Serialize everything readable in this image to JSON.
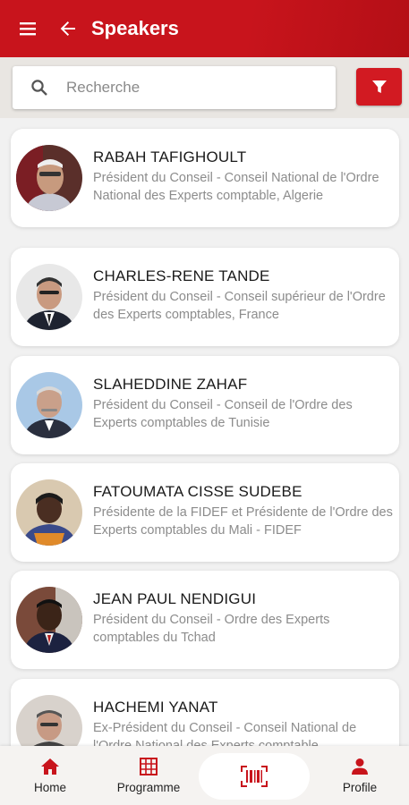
{
  "header": {
    "title": "Speakers",
    "menu_icon": "hamburger-menu-icon",
    "back_icon": "arrow-left-icon",
    "bg_color": "#c8141c"
  },
  "search": {
    "placeholder": "Recherche",
    "value": "",
    "filter_icon": "filter-funnel-icon",
    "filter_color": "#d21a22"
  },
  "speakers": [
    {
      "name": "RABAH TAFIGHOULT",
      "role": "Président du Conseil - Conseil National de l'Ordre National des Experts comptable, Algerie"
    },
    {
      "name": "CHARLES-RENE TANDE",
      "role": "Président du Conseil - Conseil supérieur de l'Ordre des Experts comptables, France"
    },
    {
      "name": "SLAHEDDINE ZAHAF",
      "role": "Président du Conseil - Conseil de l'Ordre des Experts comptables  de Tunisie"
    },
    {
      "name": "FATOUMATA CISSE SUDEBE",
      "role": "Présidente de la FIDEF et Présidente de l'Ordre des Experts comptables du Mali - FIDEF"
    },
    {
      "name": "JEAN PAUL NENDIGUI",
      "role": "Président du Conseil - Ordre des Experts comptables du Tchad"
    },
    {
      "name": "HACHEMI YANAT",
      "role": "Ex-Président du Conseil - Conseil National de l'Ordre National des Experts comptable"
    }
  ],
  "bottom_nav": {
    "home": {
      "label": "Home",
      "icon": "home-icon"
    },
    "programme": {
      "label": "Programme",
      "icon": "calendar-grid-icon"
    },
    "scan": {
      "icon": "barcode-scan-icon"
    },
    "profile": {
      "label": "Profile",
      "icon": "person-icon"
    },
    "accent_color": "#c8141c"
  }
}
